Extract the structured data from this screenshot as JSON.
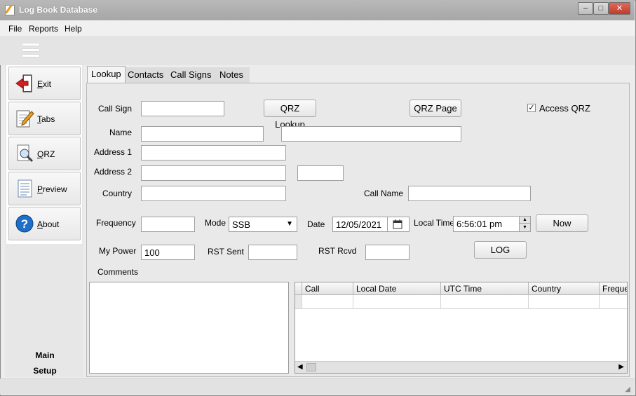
{
  "window": {
    "title": "Log Book Database"
  },
  "menu": {
    "file": "File",
    "reports": "Reports",
    "help": "Help"
  },
  "sidebar": {
    "buttons": [
      {
        "label": "Exit",
        "icon": "exit-door-icon"
      },
      {
        "label": "Tabs",
        "icon": "notepad-pencil-icon"
      },
      {
        "label": "QRZ",
        "icon": "magnifier-document-icon"
      },
      {
        "label": "Preview",
        "icon": "preview-document-icon"
      },
      {
        "label": "About",
        "icon": "question-help-icon"
      }
    ],
    "sections": {
      "main": "Main",
      "setup": "Setup"
    }
  },
  "tabs": [
    "Lookup",
    "Contacts",
    "Call Signs",
    "Notes"
  ],
  "form": {
    "call_sign_label": "Call Sign",
    "call_sign_value": "",
    "qrz_lookup_button": "QRZ Lookup",
    "qrz_page_button": "QRZ Page",
    "access_qrz_label": "Access QRZ",
    "access_qrz_checked": "✓",
    "name_label": "Name",
    "address1_label": "Address 1",
    "address2_label": "Address 2",
    "country_label": "Country",
    "call_name_label": "Call Name",
    "frequency_label": "Frequency",
    "mode_label": "Mode",
    "mode_value": "SSB",
    "date_label": "Date",
    "date_value": "12/05/2021",
    "local_time_label": "Local Time",
    "local_time_value": "6:56:01 pm",
    "now_button": "Now",
    "my_power_label": "My Power",
    "my_power_value": "100",
    "rst_sent_label": "RST Sent",
    "rst_rcvd_label": "RST Rcvd",
    "log_button": "LOG",
    "comments_label": "Comments"
  },
  "grid": {
    "columns": [
      "Call",
      "Local Date",
      "UTC Time",
      "Country",
      "Frequer"
    ]
  }
}
